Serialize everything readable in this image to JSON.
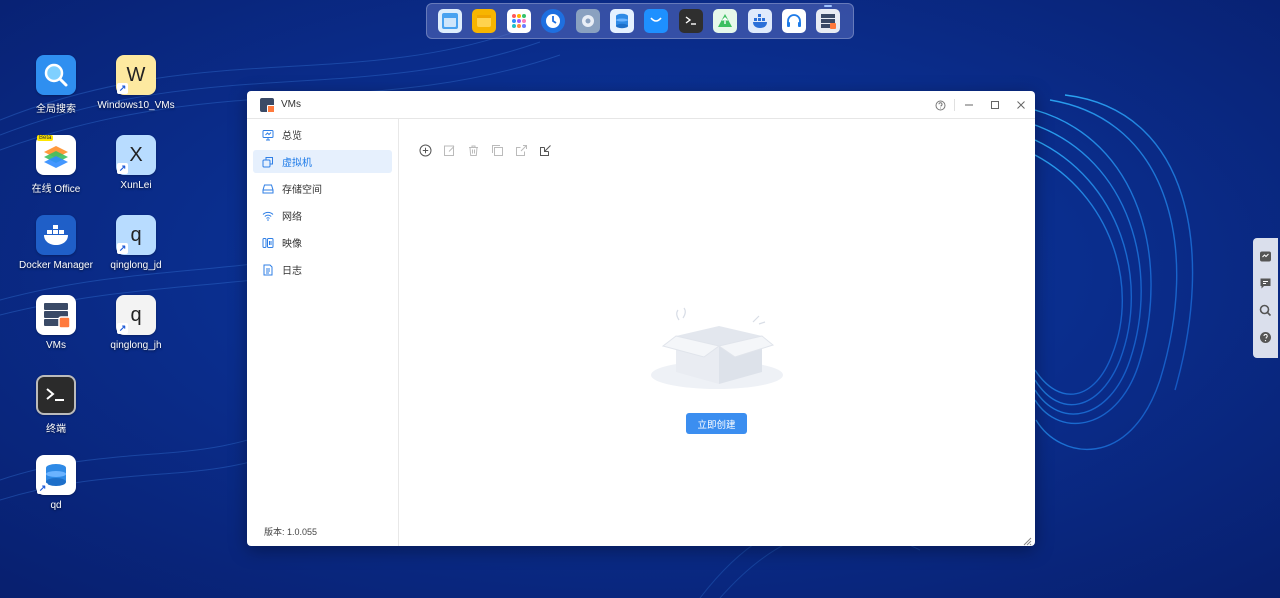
{
  "dock": {
    "apps": [
      {
        "name": "file-manager-icon",
        "color": "#4aa3f0"
      },
      {
        "name": "notes-icon",
        "color": "#f7b500"
      },
      {
        "name": "app-center-icon",
        "color": "#ffffff"
      },
      {
        "name": "backup-clock-icon",
        "color": "#1e6fe0"
      },
      {
        "name": "settings-gear-icon",
        "color": "#8aa1c0"
      },
      {
        "name": "storage-icon",
        "color": "#2e8ae6"
      },
      {
        "name": "app-store-icon",
        "color": "#1e90ff"
      },
      {
        "name": "terminal-icon",
        "color": "#333333"
      },
      {
        "name": "upload-icon",
        "color": "#3cc060"
      },
      {
        "name": "docker-icon",
        "color": "#2b6fd8"
      },
      {
        "name": "support-headset-icon",
        "color": "#1e7be8"
      },
      {
        "name": "vms-icon",
        "color": "#3a4a66"
      }
    ]
  },
  "desktop": {
    "icons": [
      {
        "label": "全局搜索",
        "glyph": ""
      },
      {
        "label": "Windows10_VMs",
        "glyph": "W"
      },
      {
        "label": "在线 Office",
        "glyph": "",
        "badge": "Beta"
      },
      {
        "label": "XunLei",
        "glyph": "X"
      },
      {
        "label": "Docker Manager",
        "glyph": ""
      },
      {
        "label": "qinglong_jd",
        "glyph": "q"
      },
      {
        "label": "VMs",
        "glyph": ""
      },
      {
        "label": "qinglong_jh",
        "glyph": "q"
      },
      {
        "label": "终端",
        "glyph": ""
      },
      {
        "label": "qd",
        "glyph": ""
      }
    ],
    "shortcut_glyph": "↗"
  },
  "window": {
    "title": "VMs",
    "sidebar": {
      "items": [
        {
          "label": "总览"
        },
        {
          "label": "虚拟机"
        },
        {
          "label": "存储空间"
        },
        {
          "label": "网络"
        },
        {
          "label": "映像"
        },
        {
          "label": "日志"
        }
      ],
      "version": "版本: 1.0.055"
    },
    "empty_state": {
      "create_label": "立即创建"
    }
  },
  "colors": {
    "accent": "#3b8ef0",
    "desktop_bg": "#0a2a8a"
  }
}
